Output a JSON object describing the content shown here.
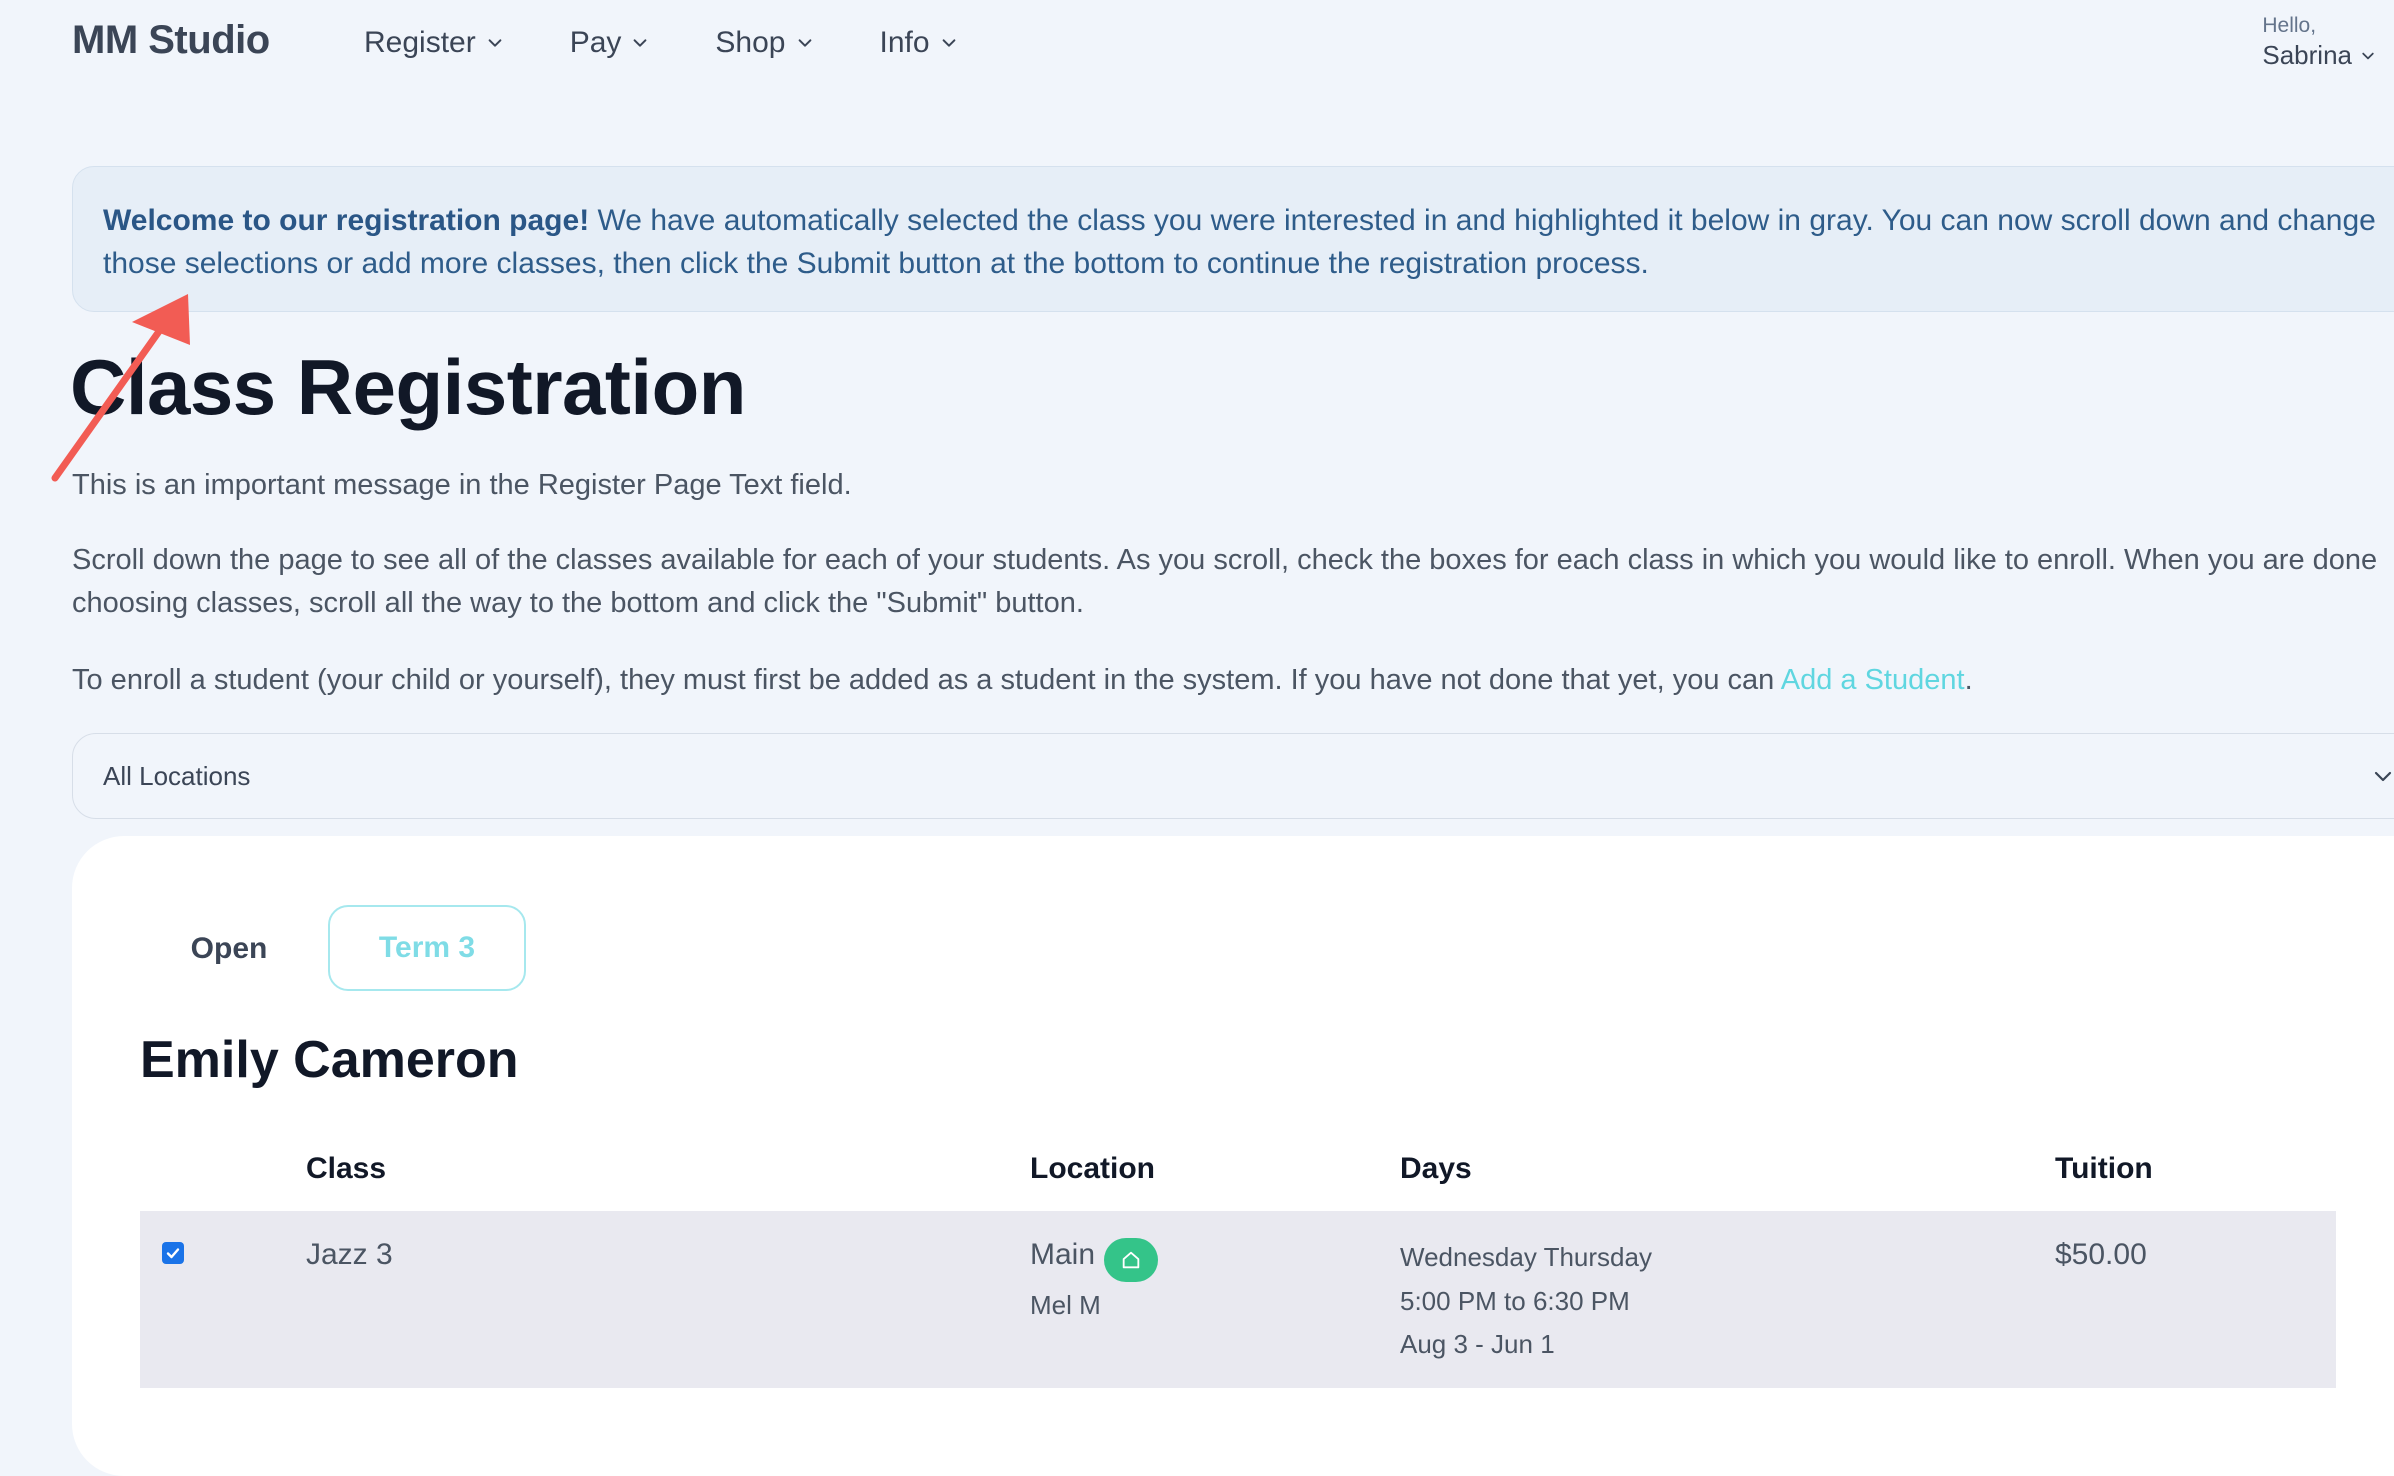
{
  "header": {
    "brand": "MM Studio",
    "nav": [
      {
        "label": "Register"
      },
      {
        "label": "Pay"
      },
      {
        "label": "Shop"
      },
      {
        "label": "Info"
      }
    ],
    "user": {
      "greeting": "Hello,",
      "name": "Sabrina"
    }
  },
  "alert": {
    "bold": "Welcome to our registration page!",
    "text": " We have automatically selected the class you were interested in and highlighted it below in gray. You can now scroll down and change those selections or add more classes, then click the Submit button at the bottom to continue the registration process."
  },
  "page": {
    "title": "Class Registration",
    "message": "This is an important message in the Register Page Text field.",
    "instructions": "Scroll down the page to see all of the classes available for each of your students. As you scroll, check the boxes for each class in which you would like to enroll. When you are done choosing classes, scroll all the way to the bottom and click the \"Submit\" button.",
    "enroll_text": "To enroll a student (your child or yourself), they must first be added as a student in the system. If you have not done that yet, you can ",
    "enroll_link": "Add a Student",
    "enroll_end": "."
  },
  "location_select": {
    "value": "All Locations"
  },
  "tabs": [
    {
      "label": "Open",
      "active": false
    },
    {
      "label": "Term 3",
      "active": true
    }
  ],
  "student": {
    "name": "Emily Cameron",
    "columns": [
      "Class",
      "Location",
      "Days",
      "Tuition"
    ],
    "rows": [
      {
        "checked": true,
        "class": "Jazz 3",
        "location": "Main",
        "instructor": "Mel M",
        "days": "Wednesday Thursday",
        "time": "5:00 PM to 6:30 PM",
        "dates": "Aug 3 - Jun 1",
        "tuition": "$50.00"
      }
    ]
  },
  "colors": {
    "accent": "#5fd6e0",
    "alert_text": "#2e5c8a",
    "highlight_row": "#e9e9f0",
    "home_badge": "#34c489",
    "annotation_arrow": "#f25c54"
  }
}
